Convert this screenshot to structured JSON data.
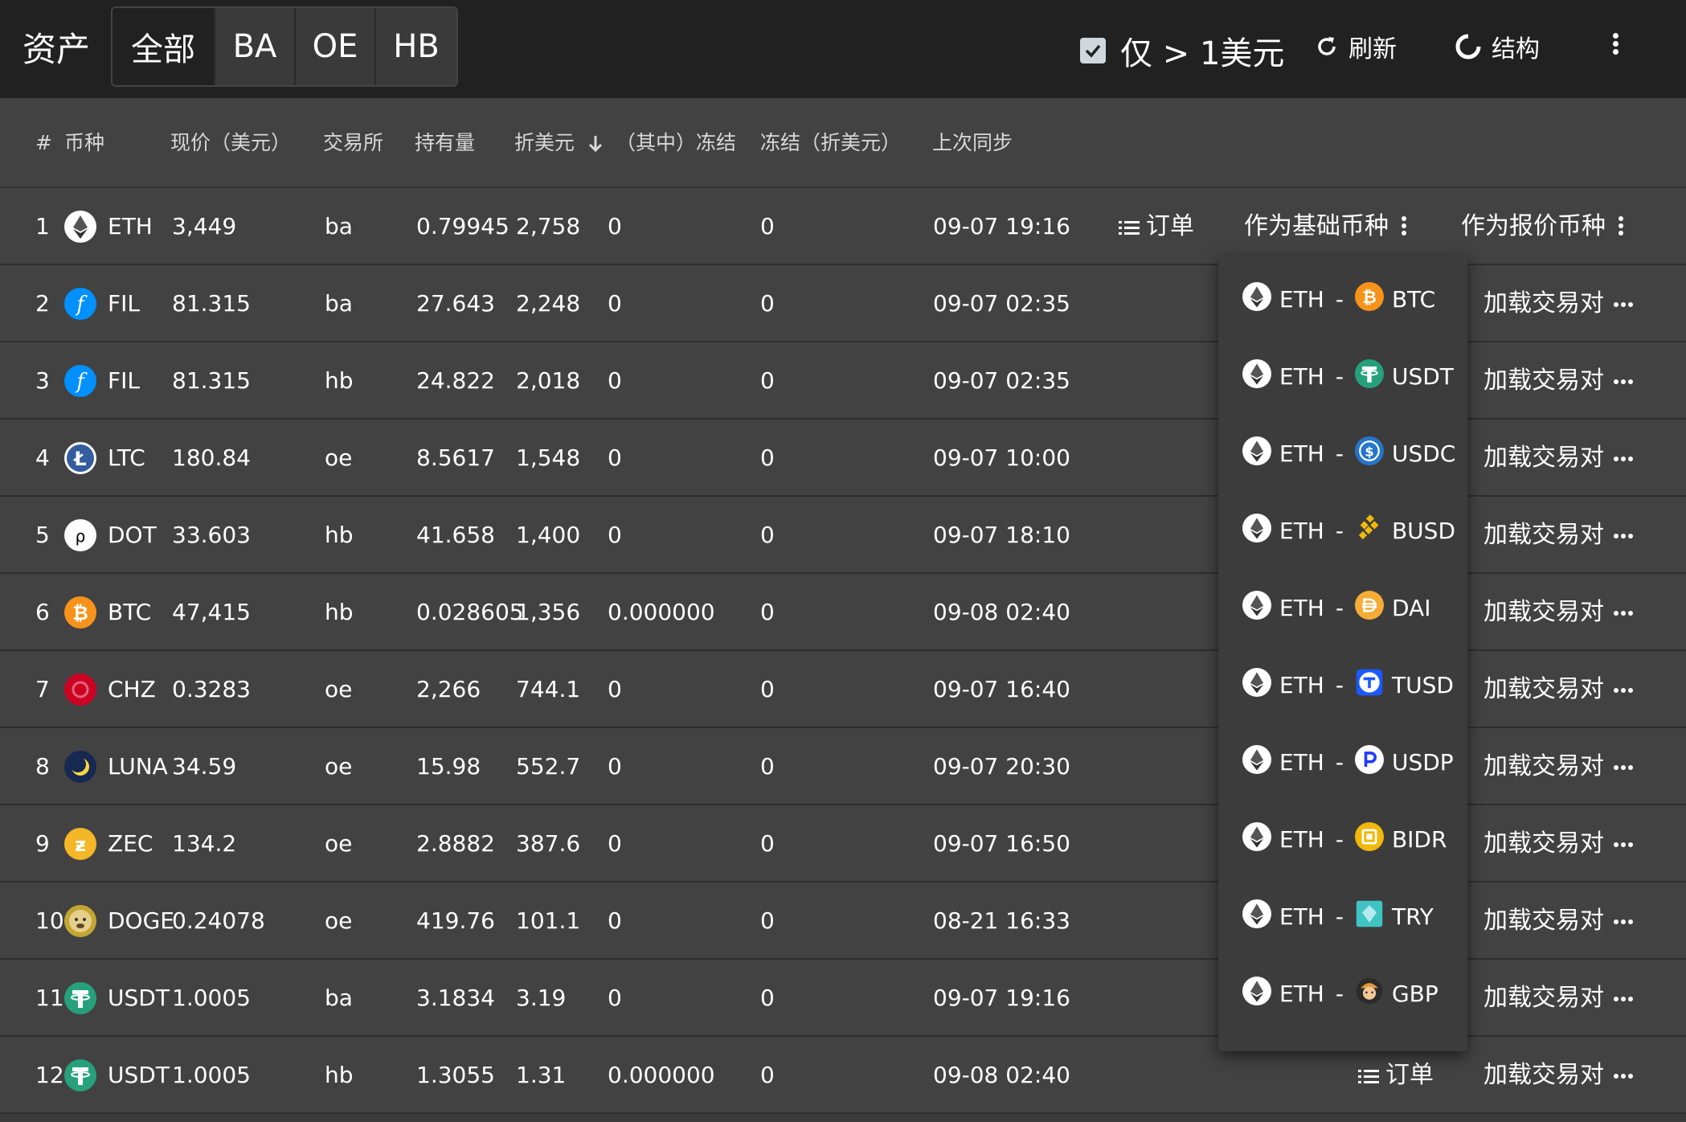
{
  "app": {
    "title": "资产"
  },
  "tabs": [
    {
      "label": "全部"
    },
    {
      "label": "BA"
    },
    {
      "label": "OE"
    },
    {
      "label": "HB"
    }
  ],
  "toolbar": {
    "filter_label": "仅 > 1美元",
    "refresh_label": "刷新",
    "structure_label": "结构"
  },
  "table": {
    "columns": {
      "num": "#",
      "coin": "币种",
      "price": "现价（美元）",
      "exchange": "交易所",
      "holding": "持有量",
      "usd": "折美元",
      "frozen": "（其中）冻结",
      "frozen_usd": "冻结（折美元）",
      "last_sync": "上次同步"
    },
    "rows": [
      {
        "num": "1",
        "coin": "ETH",
        "price": "3,449",
        "exchange": "ba",
        "holding": "0.79945",
        "usd": "2,758",
        "frozen": "0",
        "frozen_usd": "0",
        "sync": "09-07 19:16"
      },
      {
        "num": "2",
        "coin": "FIL",
        "price": "81.315",
        "exchange": "ba",
        "holding": "27.643",
        "usd": "2,248",
        "frozen": "0",
        "frozen_usd": "0",
        "sync": "09-07 02:35"
      },
      {
        "num": "3",
        "coin": "FIL",
        "price": "81.315",
        "exchange": "hb",
        "holding": "24.822",
        "usd": "2,018",
        "frozen": "0",
        "frozen_usd": "0",
        "sync": "09-07 02:35"
      },
      {
        "num": "4",
        "coin": "LTC",
        "price": "180.84",
        "exchange": "oe",
        "holding": "8.5617",
        "usd": "1,548",
        "frozen": "0",
        "frozen_usd": "0",
        "sync": "09-07 10:00"
      },
      {
        "num": "5",
        "coin": "DOT",
        "price": "33.603",
        "exchange": "hb",
        "holding": "41.658",
        "usd": "1,400",
        "frozen": "0",
        "frozen_usd": "0",
        "sync": "09-07 18:10"
      },
      {
        "num": "6",
        "coin": "BTC",
        "price": "47,415",
        "exchange": "hb",
        "holding": "0.028605",
        "usd": "1,356",
        "frozen": "0.000000",
        "frozen_usd": "0",
        "sync": "09-08 02:40"
      },
      {
        "num": "7",
        "coin": "CHZ",
        "price": "0.3283",
        "exchange": "oe",
        "holding": "2,266",
        "usd": "744.1",
        "frozen": "0",
        "frozen_usd": "0",
        "sync": "09-07 16:40"
      },
      {
        "num": "8",
        "coin": "LUNA",
        "price": "34.59",
        "exchange": "oe",
        "holding": "15.98",
        "usd": "552.7",
        "frozen": "0",
        "frozen_usd": "0",
        "sync": "09-07 20:30"
      },
      {
        "num": "9",
        "coin": "ZEC",
        "price": "134.2",
        "exchange": "oe",
        "holding": "2.8882",
        "usd": "387.6",
        "frozen": "0",
        "frozen_usd": "0",
        "sync": "09-07 16:50"
      },
      {
        "num": "10",
        "coin": "DOGE",
        "price": "0.24078",
        "exchange": "oe",
        "holding": "419.76",
        "usd": "101.1",
        "frozen": "0",
        "frozen_usd": "0",
        "sync": "08-21 16:33"
      },
      {
        "num": "11",
        "coin": "USDT",
        "price": "1.0005",
        "exchange": "ba",
        "holding": "3.1834",
        "usd": "3.19",
        "frozen": "0",
        "frozen_usd": "0",
        "sync": "09-07 19:16"
      },
      {
        "num": "12",
        "coin": "USDT",
        "price": "1.0005",
        "exchange": "hb",
        "holding": "1.3055",
        "usd": "1.31",
        "frozen": "0.000000",
        "frozen_usd": "0",
        "sync": "09-08 02:40"
      }
    ]
  },
  "actions": {
    "orders": "订单",
    "as_base": "作为基础币种",
    "as_quote": "作为报价币种",
    "load_pair": "加载交易对"
  },
  "pair_menu": {
    "base": "ETH",
    "sep": "-",
    "quotes": [
      "BTC",
      "USDT",
      "USDC",
      "BUSD",
      "DAI",
      "TUSD",
      "USDP",
      "BIDR",
      "TRY",
      "GBP"
    ]
  },
  "colors": {
    "topbar": "#212121",
    "table_bg": "#424242",
    "menu_bg": "#3c3c3c",
    "eth": "#ffffff",
    "fil": "#0090ff",
    "ltc": "#345d9d",
    "btc": "#f7931a",
    "chz": "#cd0124",
    "luna": "#172852",
    "zec": "#f4b728",
    "doge": "#c2a633",
    "usdt": "#26a17b",
    "usdc": "#2775ca",
    "busd": "#f0b90b",
    "dai": "#f5ac37",
    "tusd": "#1a5aff",
    "usdp": "#1f3aff",
    "bidr": "#f0b90b",
    "try": "#3fc4c4",
    "gbp": "#e09a3a"
  },
  "icons": {
    "checkbox": "checkbox-checked-icon",
    "refresh": "refresh-icon",
    "structure": "circle-notch-icon",
    "menu": "vertical-dots-icon",
    "sort": "arrow-down-icon",
    "list": "list-icon"
  }
}
